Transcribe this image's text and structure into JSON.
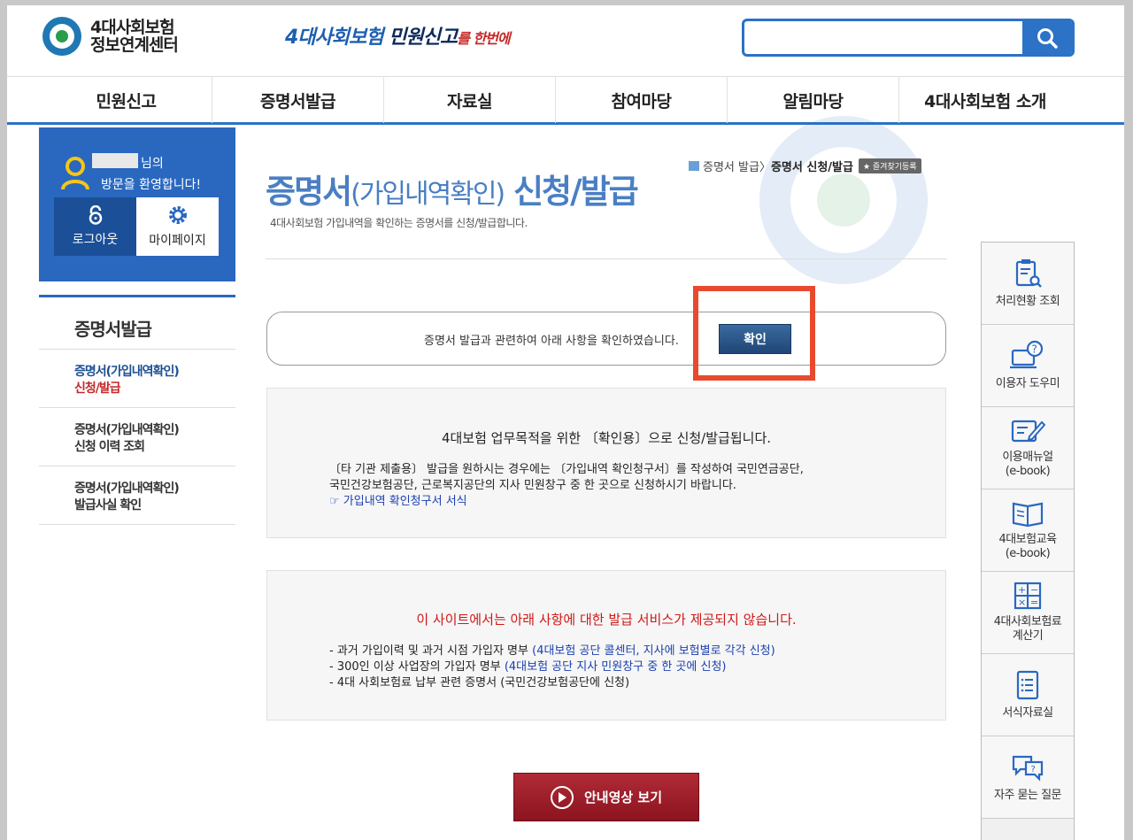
{
  "header": {
    "logo_line1": "4대사회보험",
    "logo_line2": "정보연계센터",
    "banner_part1": "4대사회보험 ",
    "banner_part2": "민원신고",
    "banner_part3": "를 한번에",
    "search_placeholder": ""
  },
  "nav": [
    "민원신고",
    "증명서발급",
    "자료실",
    "참여마당",
    "알림마당",
    "4대사회보험 소개"
  ],
  "user": {
    "name_suffix": "님의",
    "welcome": "방문을 환영합니다!",
    "logout_label": "로그아웃",
    "mypage_label": "마이페이지"
  },
  "sidebar": {
    "title": "증명서발급",
    "items": [
      {
        "line1": "증명서(가입내역확인)",
        "line2": "신청/발급"
      },
      {
        "line1": "증명서(가입내역확인)",
        "line2": "신청 이력 조회"
      },
      {
        "line1": "증명서(가입내역확인)",
        "line2": "발급사실 확인"
      }
    ]
  },
  "breadcrumb": {
    "parent": "증명서 발급",
    "separator": "〉",
    "current": "증명서 신청/발급",
    "bookmark": "★ 즐겨찾기등록"
  },
  "page": {
    "title_a": "증명서",
    "title_b": "(가입내역확인)",
    "title_c": " 신청/발급",
    "subtitle": "4대사회보험 가입내역을 확인하는 증명서를 신청/발급합니다."
  },
  "confirm": {
    "text": "증명서 발급과 관련하여 아래 사항을 확인하였습니다.",
    "button": "확인"
  },
  "info": {
    "title": "4대보험 업무목적을 위한 〔확인용〕으로 신청/발급됩니다.",
    "line1": "〔타 기관 제출용〕 발급을 원하시는 경우에는 〔가입내역 확인청구서〕를 작성하여 국민연금공단,",
    "line2": "국민건강보험공단, 근로복지공단의 지사 민원창구 중 한 곳으로 신청하시기 바랍니다.",
    "link": "☞ 가입내역 확인청구서 서식"
  },
  "notice": {
    "title": "이 사이트에서는 아래 사항에 대한 발급 서비스가 제공되지 않습니다.",
    "items": [
      {
        "text": "- 과거 가입이력 및 과거 시점 가입자 명부 ",
        "hl": "(4대보험 공단 콜센터, 지사에 보험별로 각각 신청)"
      },
      {
        "text": "- 300인 이상 사업장의 가입자 명부 ",
        "hl": "(4대보험 공단 지사 민원창구 중 한 곳에 신청)"
      },
      {
        "text": "- 4대 사회보험료 납부 관련 증명서 (국민건강보험공단에 신청)",
        "hl": ""
      }
    ]
  },
  "video_button": "안내영상 보기",
  "quick_menu": [
    {
      "icon": "clipboard-search-icon",
      "l1": "처리현황 조회",
      "l2": ""
    },
    {
      "icon": "help-monitor-icon",
      "l1": "이용자 도우미",
      "l2": ""
    },
    {
      "icon": "edit-manual-icon",
      "l1": "이용매뉴얼",
      "l2": "(e-book)"
    },
    {
      "icon": "book-icon",
      "l1": "4대보험교육",
      "l2": "(e-book)"
    },
    {
      "icon": "calculator-icon",
      "l1": "4대사회보험료",
      "l2": "계산기"
    },
    {
      "icon": "document-list-icon",
      "l1": "서식자료실",
      "l2": ""
    },
    {
      "icon": "chat-faq-icon",
      "l1": "자주 묻는 질문",
      "l2": ""
    }
  ],
  "colors": {
    "brand_blue": "#2c72c7",
    "title_blue": "#4a7fc2",
    "alert_red": "#d01818",
    "highlight": "#e84a2e"
  }
}
